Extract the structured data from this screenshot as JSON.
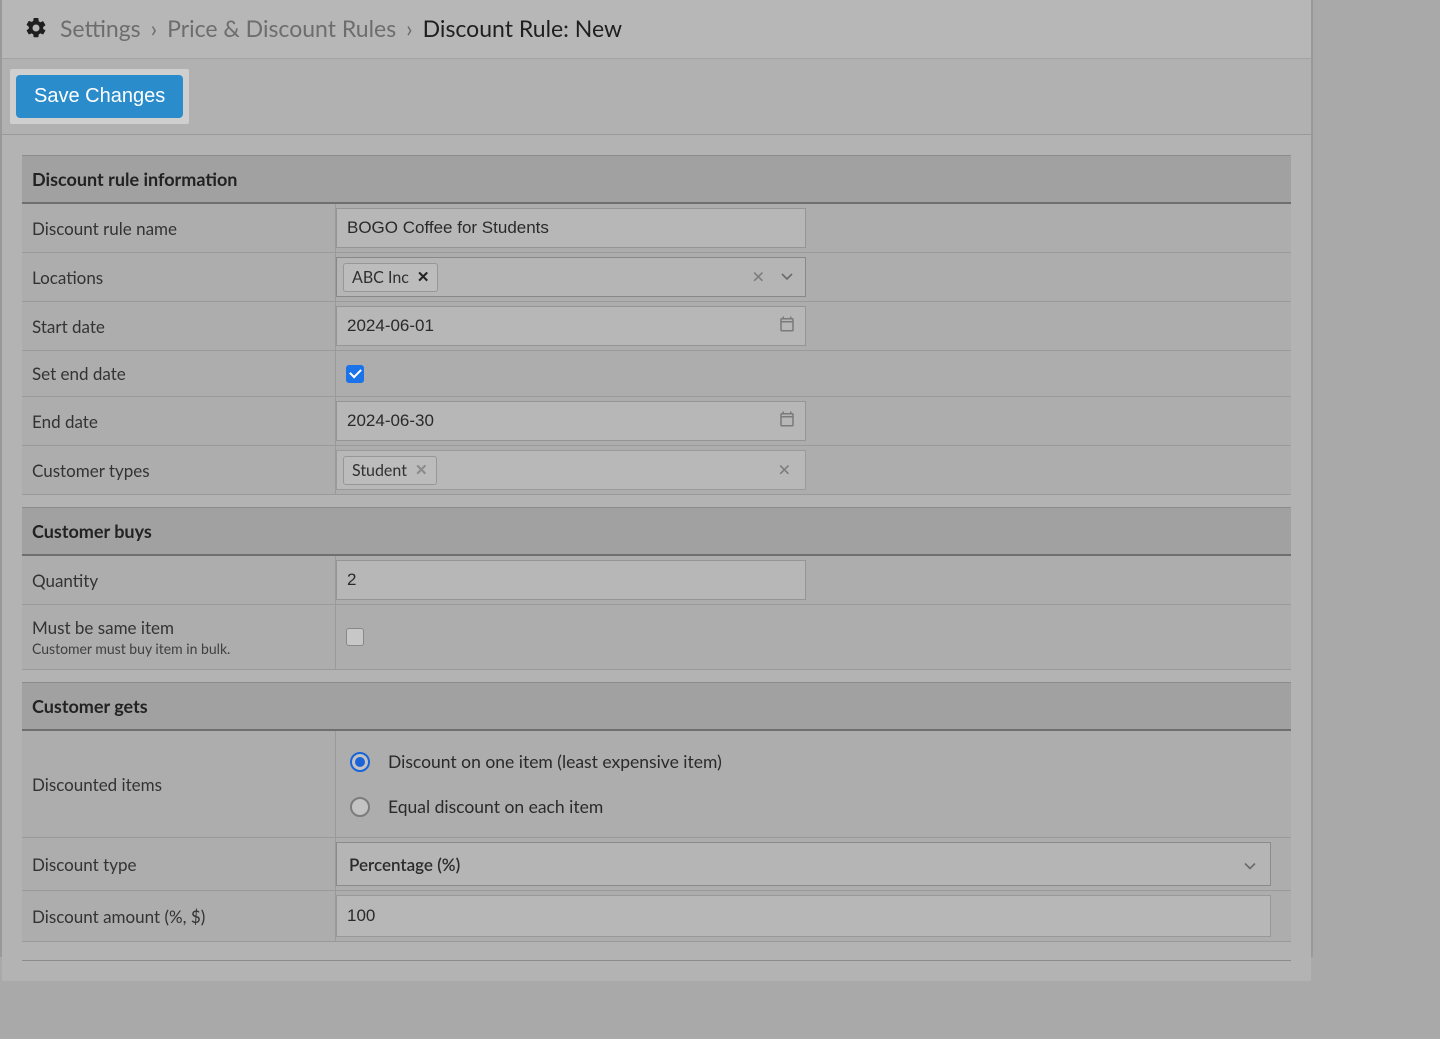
{
  "breadcrumb": {
    "settings": "Settings",
    "rules": "Price & Discount Rules",
    "current": "Discount Rule: New"
  },
  "toolbar": {
    "save_label": "Save Changes"
  },
  "sections": {
    "info": "Discount rule information",
    "buys": "Customer buys",
    "gets": "Customer gets"
  },
  "info": {
    "name_label": "Discount rule name",
    "name_value": "BOGO Coffee for Students",
    "locations_label": "Locations",
    "locations_tag": "ABC Inc",
    "start_label": "Start date",
    "start_value": "2024-06-01",
    "set_end_label": "Set end date",
    "set_end_checked": true,
    "end_label": "End date",
    "end_value": "2024-06-30",
    "ctypes_label": "Customer types",
    "ctypes_tag": "Student"
  },
  "buys": {
    "qty_label": "Quantity",
    "qty_value": "2",
    "same_label": "Must be same item",
    "same_sub": "Customer must buy item in bulk.",
    "same_checked": false
  },
  "gets": {
    "discounted_label": "Discounted items",
    "opt_one": "Discount on one item (least expensive item)",
    "opt_each": "Equal discount on each item",
    "selected": "one",
    "type_label": "Discount type",
    "type_value": "Percentage   (%)",
    "amount_label": "Discount amount (%, $)",
    "amount_value": "100"
  }
}
